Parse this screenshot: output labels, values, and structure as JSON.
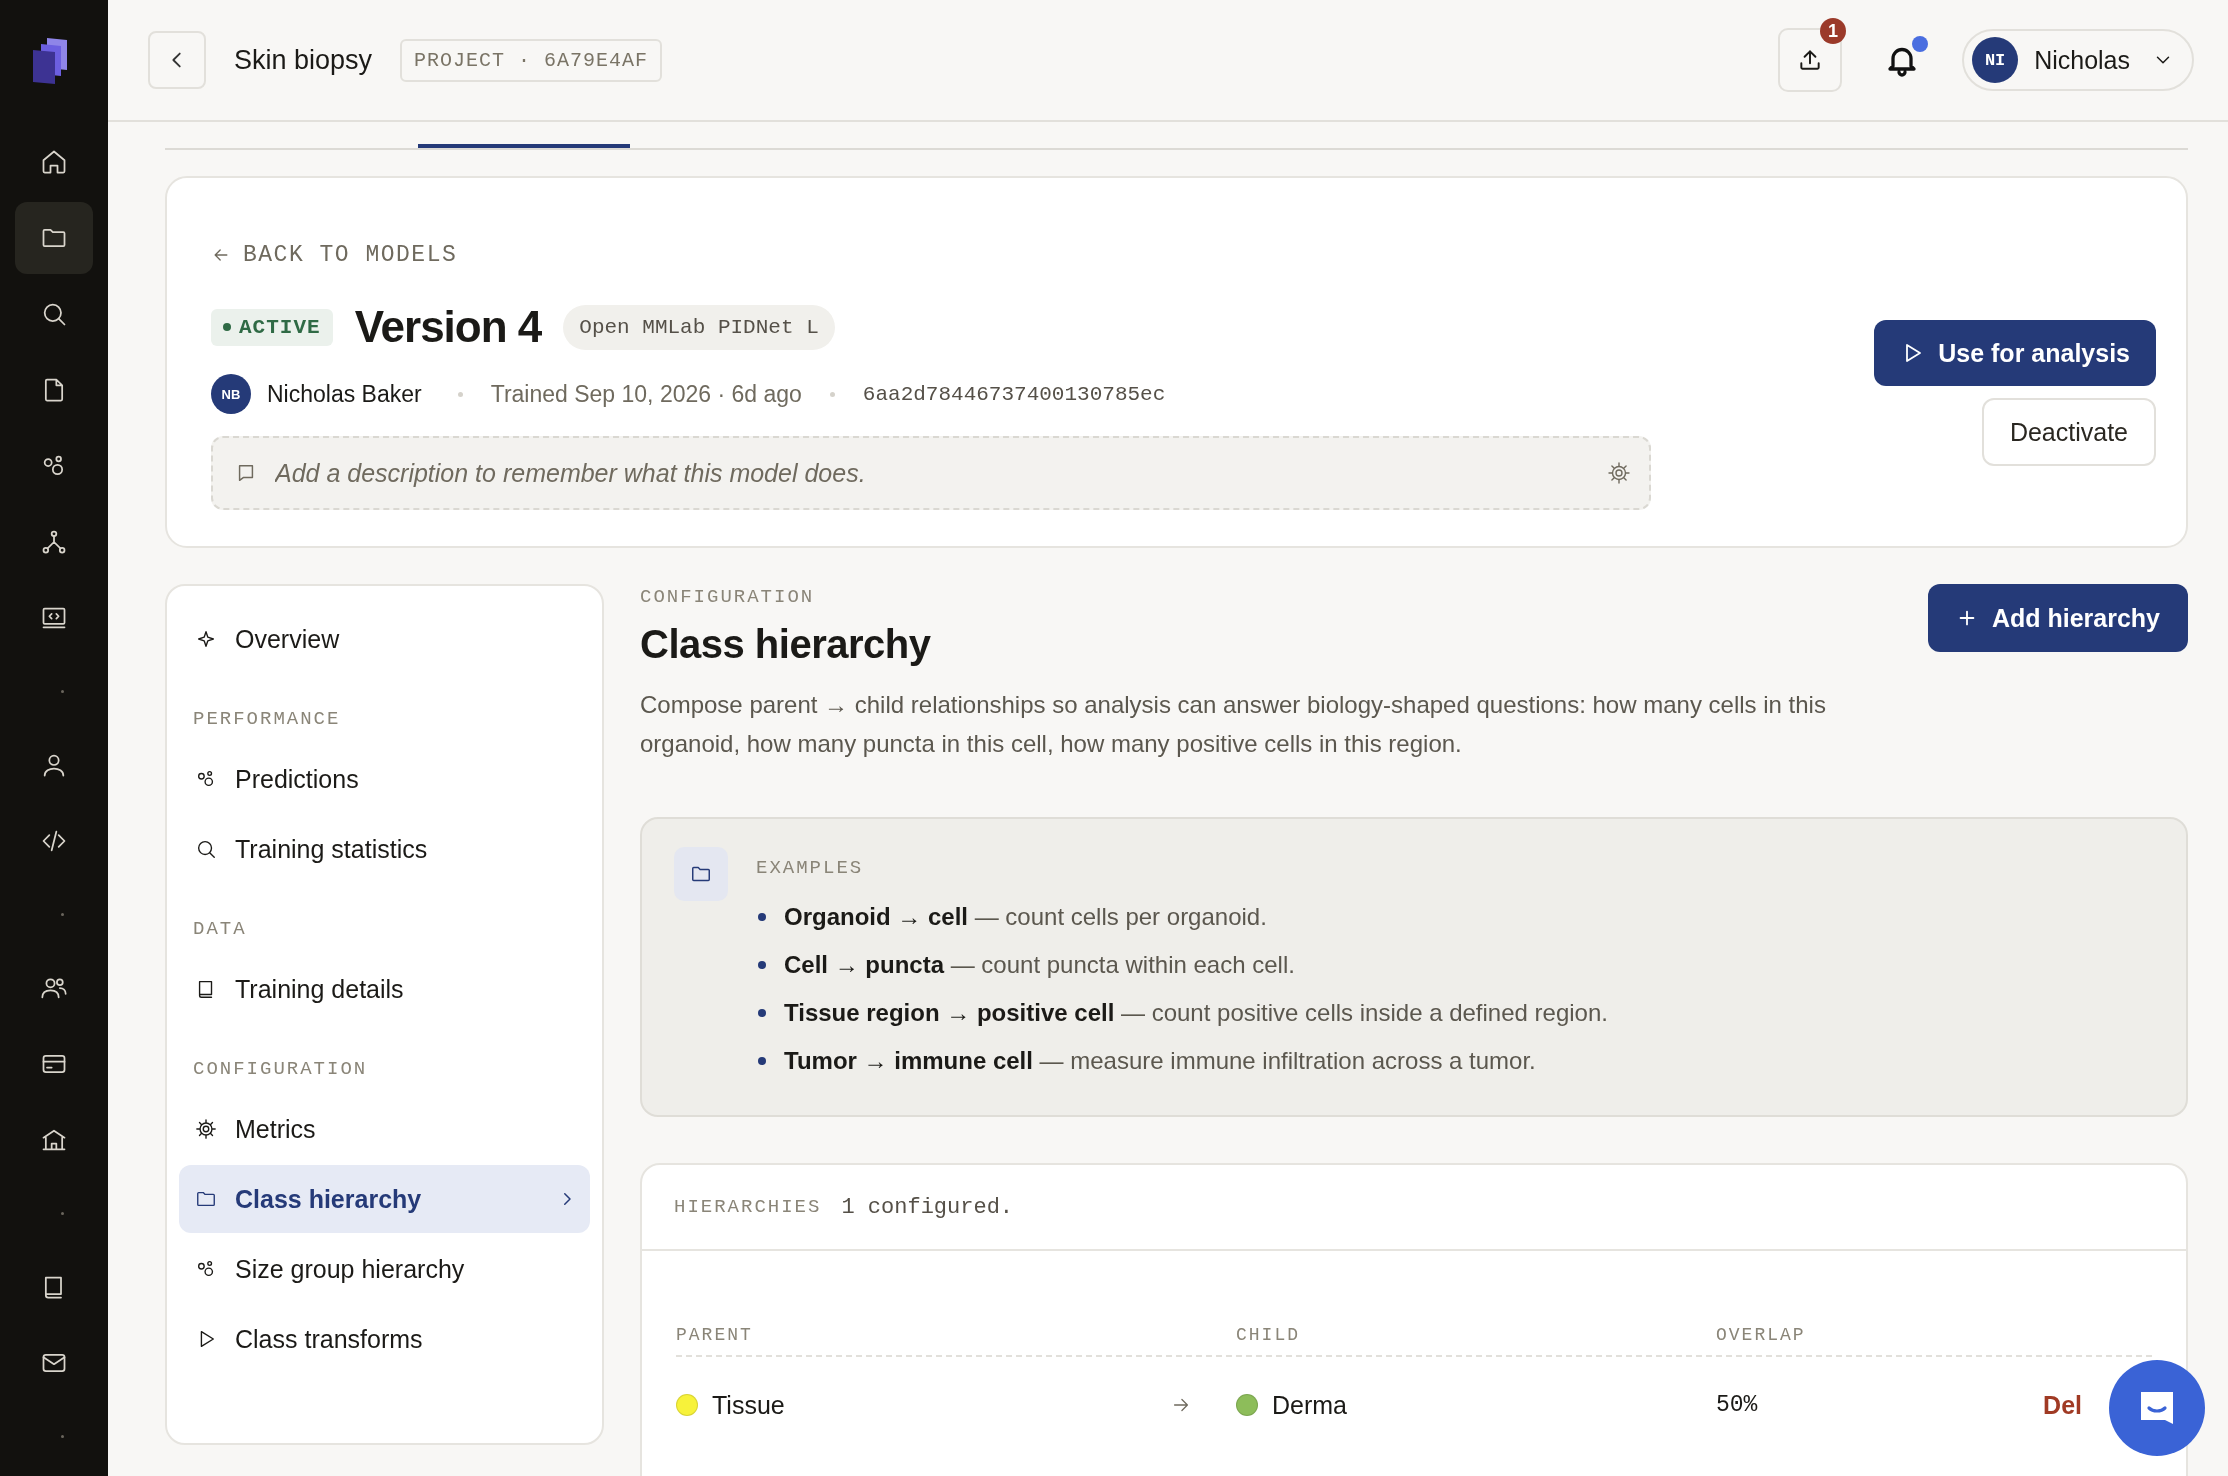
{
  "sidebar": {
    "items": [
      {
        "kind": "button",
        "selected": false
      },
      {
        "kind": "button",
        "selected": true
      },
      {
        "kind": "button",
        "selected": false
      },
      {
        "kind": "button",
        "selected": false
      },
      {
        "kind": "button",
        "selected": false
      },
      {
        "kind": "button",
        "selected": false
      },
      {
        "kind": "button",
        "selected": false
      },
      {
        "kind": "separator"
      },
      {
        "kind": "button",
        "selected": false
      },
      {
        "kind": "button",
        "selected": false
      },
      {
        "kind": "separator"
      },
      {
        "kind": "button",
        "selected": false
      },
      {
        "kind": "button",
        "selected": false
      },
      {
        "kind": "button",
        "selected": false
      },
      {
        "kind": "separator"
      },
      {
        "kind": "button",
        "selected": false
      },
      {
        "kind": "button",
        "selected": false
      },
      {
        "kind": "separator"
      }
    ]
  },
  "top_bar": {
    "title": "Skin biopsy",
    "project_tag": "PROJECT · 6A79E4AF",
    "upload_badge": "1",
    "notifications": {
      "unread": true
    },
    "user": {
      "initials": "NI",
      "name": "Nicholas"
    }
  },
  "tabs": [
    {
      "selected": false
    },
    {
      "selected": true
    }
  ],
  "model": {
    "back_link": "BACK TO MODELS",
    "status": {
      "label": "ACTIVE",
      "active": true
    },
    "title": "Version 4",
    "architecture": "Open MMLab PIDNet L",
    "author_initials": "NB",
    "author": "Nicholas Baker",
    "trained": "Trained Sep 10, 2026 · 6d ago",
    "hash": "6aa2d78446737400130785ec",
    "description": {
      "placeholder": "Add a description to remember what this model does."
    },
    "actions": [
      {
        "label": "Use for analysis",
        "kind": "primary"
      },
      {
        "label": "Deactivate",
        "kind": "secondary"
      }
    ]
  },
  "nav": {
    "items": [
      {
        "kind": "item",
        "label": "Overview",
        "selected": false
      },
      {
        "kind": "heading",
        "label": "PERFORMANCE"
      },
      {
        "kind": "item",
        "label": "Predictions",
        "selected": false
      },
      {
        "kind": "item",
        "label": "Training statistics",
        "selected": false
      },
      {
        "kind": "heading",
        "label": "DATA"
      },
      {
        "kind": "item",
        "label": "Training details",
        "selected": false
      },
      {
        "kind": "heading",
        "label": "CONFIGURATION"
      },
      {
        "kind": "item",
        "label": "Metrics",
        "selected": false
      },
      {
        "kind": "item",
        "label": "Class hierarchy",
        "selected": true
      },
      {
        "kind": "item",
        "label": "Size group hierarchy",
        "selected": false
      },
      {
        "kind": "item",
        "label": "Class transforms",
        "selected": false
      }
    ]
  },
  "section": {
    "eyebrow": "CONFIGURATION",
    "title": "Class hierarchy",
    "description": "Compose parent → child relationships so analysis can answer biology-shaped questions: how many cells in this organoid, how many puncta in this cell, how many positive cells in this region.",
    "add_button": "Add hierarchy",
    "examples": {
      "label": "EXAMPLES",
      "items": [
        "**Organoid → cell** — count cells per organoid.",
        "**Cell → puncta** — count puncta within each cell.",
        "**Tissue region → positive cell** — count positive cells inside a defined region.",
        "**Tumor → immune cell** — measure immune infiltration across a tumor."
      ]
    },
    "hierarchies": {
      "label": "HIERARCHIES",
      "count": "1 configured.",
      "columns": [
        "PARENT",
        "CHILD",
        "OVERLAP"
      ],
      "rows": [
        {
          "parent": {
            "name": "Tissue",
            "color": "#f7f23a"
          },
          "child": {
            "name": "Derma",
            "color": "#8dbd5a"
          },
          "overlap": "50%",
          "action": "Del"
        }
      ]
    }
  }
}
